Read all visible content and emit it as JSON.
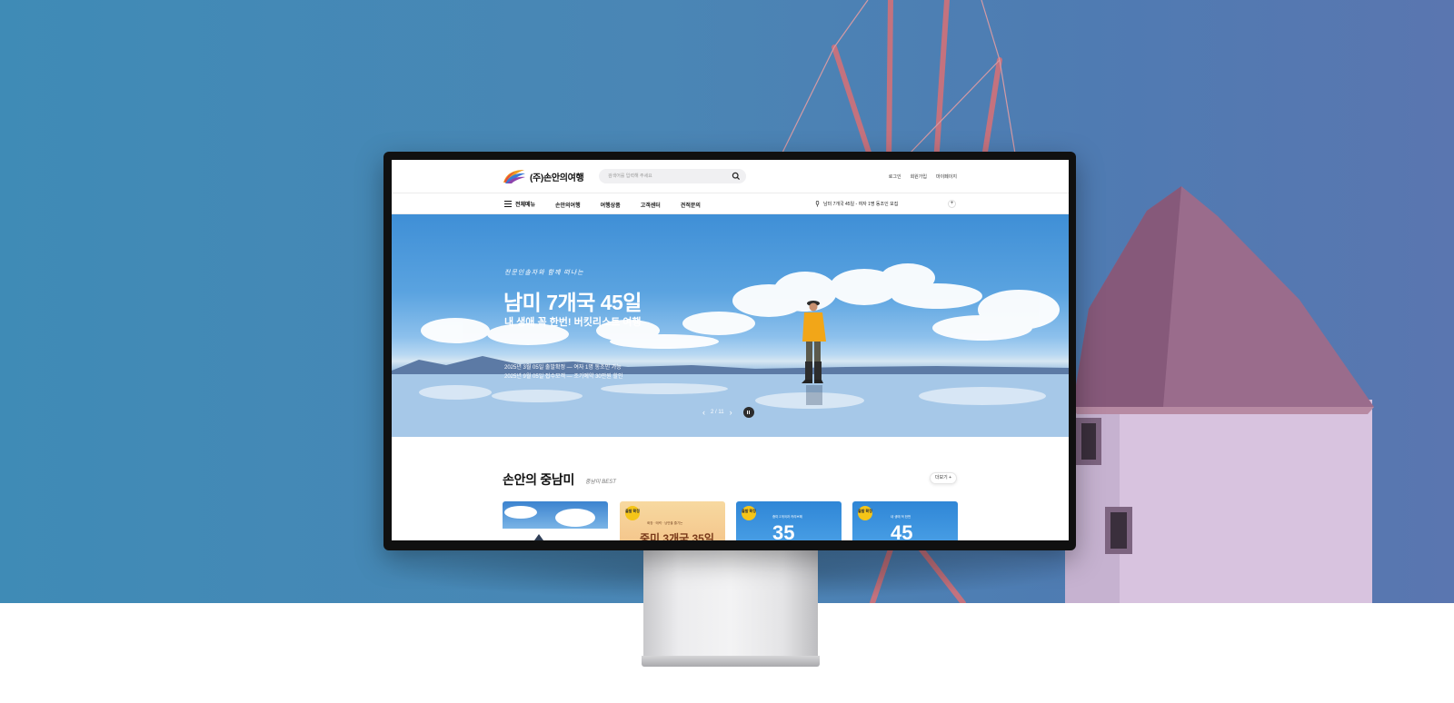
{
  "site": {
    "logo_text": "(주)손안의여행",
    "search_placeholder": "검색어를 입력해 주세요",
    "util_links": [
      "로그인",
      "회원가입",
      "마이페이지"
    ],
    "nav_all": "전체메뉴",
    "nav_items": [
      "손안의여행",
      "여행상품",
      "고객센터",
      "견적문의"
    ],
    "notice": "남미 7개국 45일 - 여자 1명 동조인 모집",
    "plus_label": "+"
  },
  "hero": {
    "script": "전문인솔자와 함께 떠나는",
    "title": "남미 7개국 45일",
    "subtitle": "내 생애 꼭 한번! 버킷리스트 여행",
    "line1": "2025년 3월 05일 출발확정 — 여자 1명 동조인 가능",
    "line2": "2025년 9월 05일 접수모객 — 조기예약 30만원 할인",
    "pager": "2 / 11",
    "prev": "‹",
    "next": "›"
  },
  "section": {
    "title": "손안의 중남미",
    "subtitle": "중남미 BEST",
    "more_label": "더보기 +",
    "cards": [
      {
        "badge": "",
        "big": "",
        "small": ""
      },
      {
        "badge": "출발\n확정",
        "big": "중미 3개국 35일",
        "small": "화창 · 매력 · 낭만을 즐기는"
      },
      {
        "badge": "출발\n확정",
        "big": "35",
        "small": "중미 2개국과 카리브해"
      },
      {
        "badge": "출발\n확정",
        "big": "45",
        "small": "내 생애 꼭 한번"
      }
    ]
  },
  "colors": {
    "bg_blue": "#4a86b5",
    "badge": "#f5c518",
    "monitor_bezel": "#101010"
  }
}
